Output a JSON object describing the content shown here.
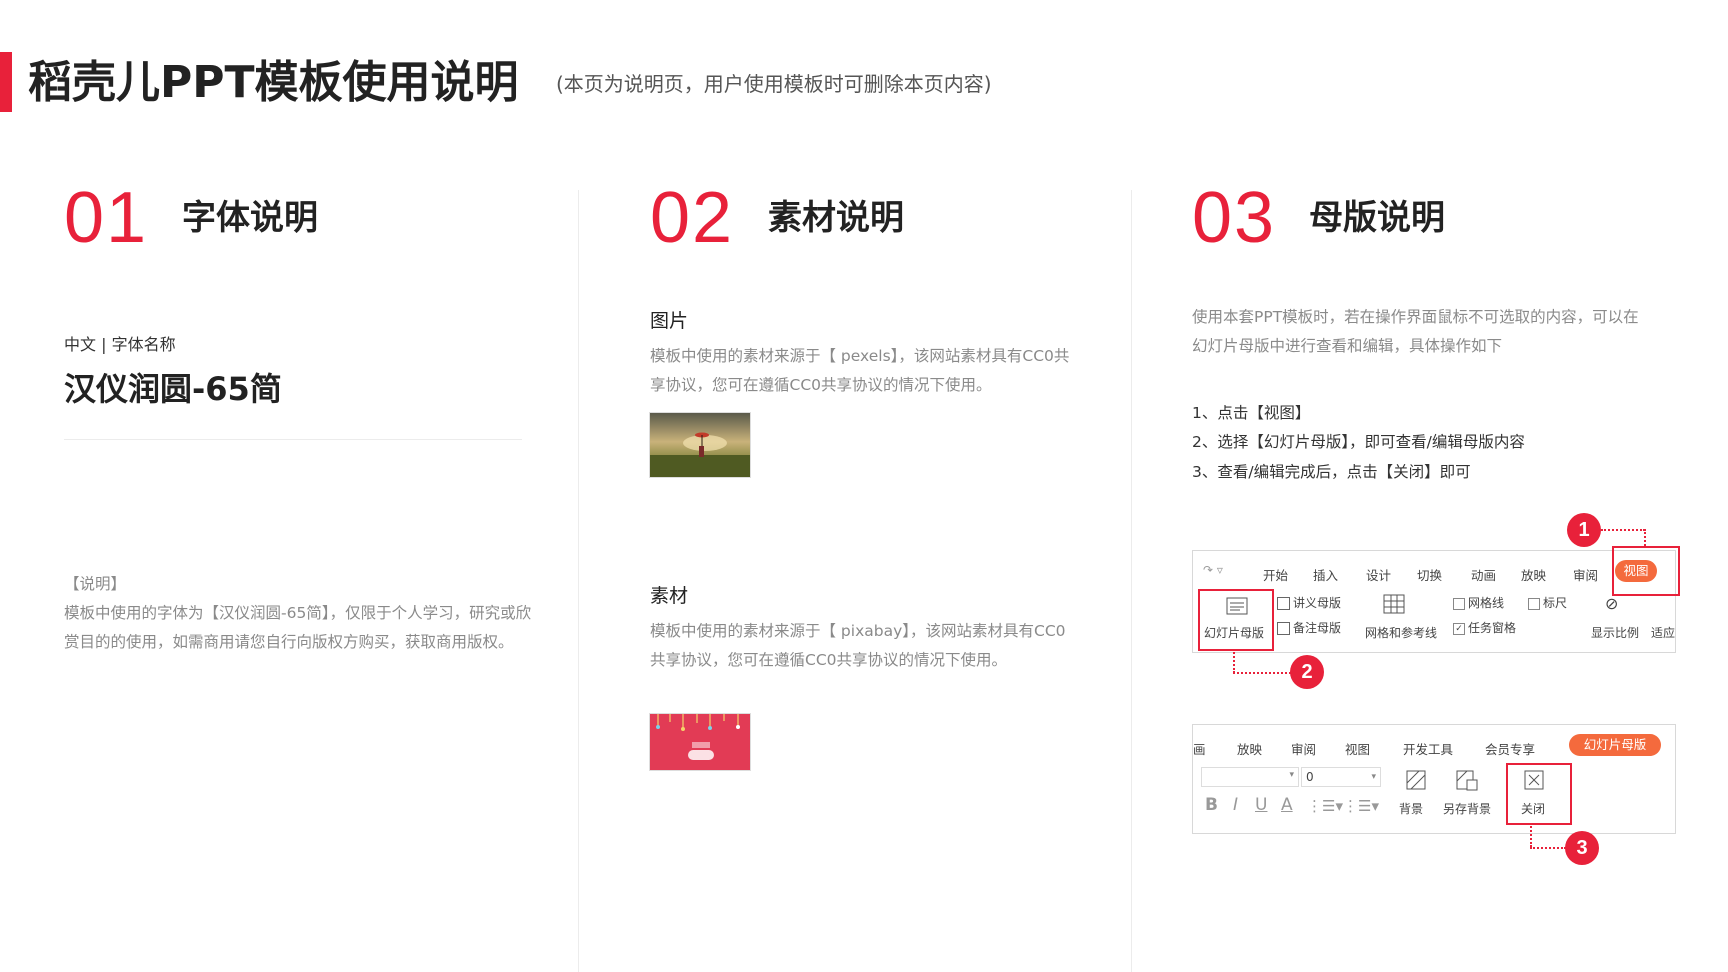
{
  "header": {
    "title": "稻壳儿PPT模板使用说明",
    "subtitle": "(本页为说明页，用户使用模板时可删除本页内容)"
  },
  "sections": [
    {
      "number": "01",
      "title": "字体说明",
      "label": "中文 | 字体名称",
      "font_name": "汉仪润圆-65简",
      "note_title": "【说明】",
      "note_text": "模板中使用的字体为【汉仪润圆-65简】，仅限于个人学习，研究或欣赏目的的使用，如需商用请您自行向版权方购买，获取商用版权。"
    },
    {
      "number": "02",
      "title": "素材说明",
      "image_head": "图片",
      "image_text": "模板中使用的素材来源于【 pexels】，该网站素材具有CC0共享协议，您可在遵循CC0共享协议的情况下使用。",
      "asset_head": "素材",
      "asset_text": "模板中使用的素材来源于【 pixabay】，该网站素材具有CC0共享协议，您可在遵循CC0共享协议的情况下使用。"
    },
    {
      "number": "03",
      "title": "母版说明",
      "intro": "使用本套PPT模板时，若在操作界面鼠标不可选取的内容，可以在幻灯片母版中进行查看和编辑，具体操作如下",
      "steps": [
        "1、点击【视图】",
        "2、选择【幻灯片母版】，即可查看/编辑母版内容",
        "3、查看/编辑完成后，点击【关闭】即可"
      ]
    }
  ],
  "toolbar1": {
    "tabs": [
      "开始",
      "插入",
      "设计",
      "切换",
      "动画",
      "放映",
      "审阅"
    ],
    "active_tab": "视图",
    "slide_master": "幻灯片母版",
    "handout_master": "讲义母版",
    "notes_master": "备注母版",
    "grid_guides": "网格和参考线",
    "gridlines": "网格线",
    "ruler": "标尺",
    "task_pane": "任务窗格",
    "zoom": "显示比例",
    "fit": "适应"
  },
  "toolbar2": {
    "tabs": [
      "画",
      "放映",
      "审阅",
      "视图",
      "开发工具",
      "会员专享"
    ],
    "active_tab": "幻灯片母版",
    "font_size": "0",
    "format_buttons": [
      "B",
      "I",
      "U",
      "A"
    ],
    "background": "背景",
    "save_background": "另存背景",
    "close": "关闭"
  },
  "badges": [
    "1",
    "2",
    "3"
  ],
  "colors": {
    "accent": "#e8213a",
    "active_tab": "#f46a3d"
  }
}
